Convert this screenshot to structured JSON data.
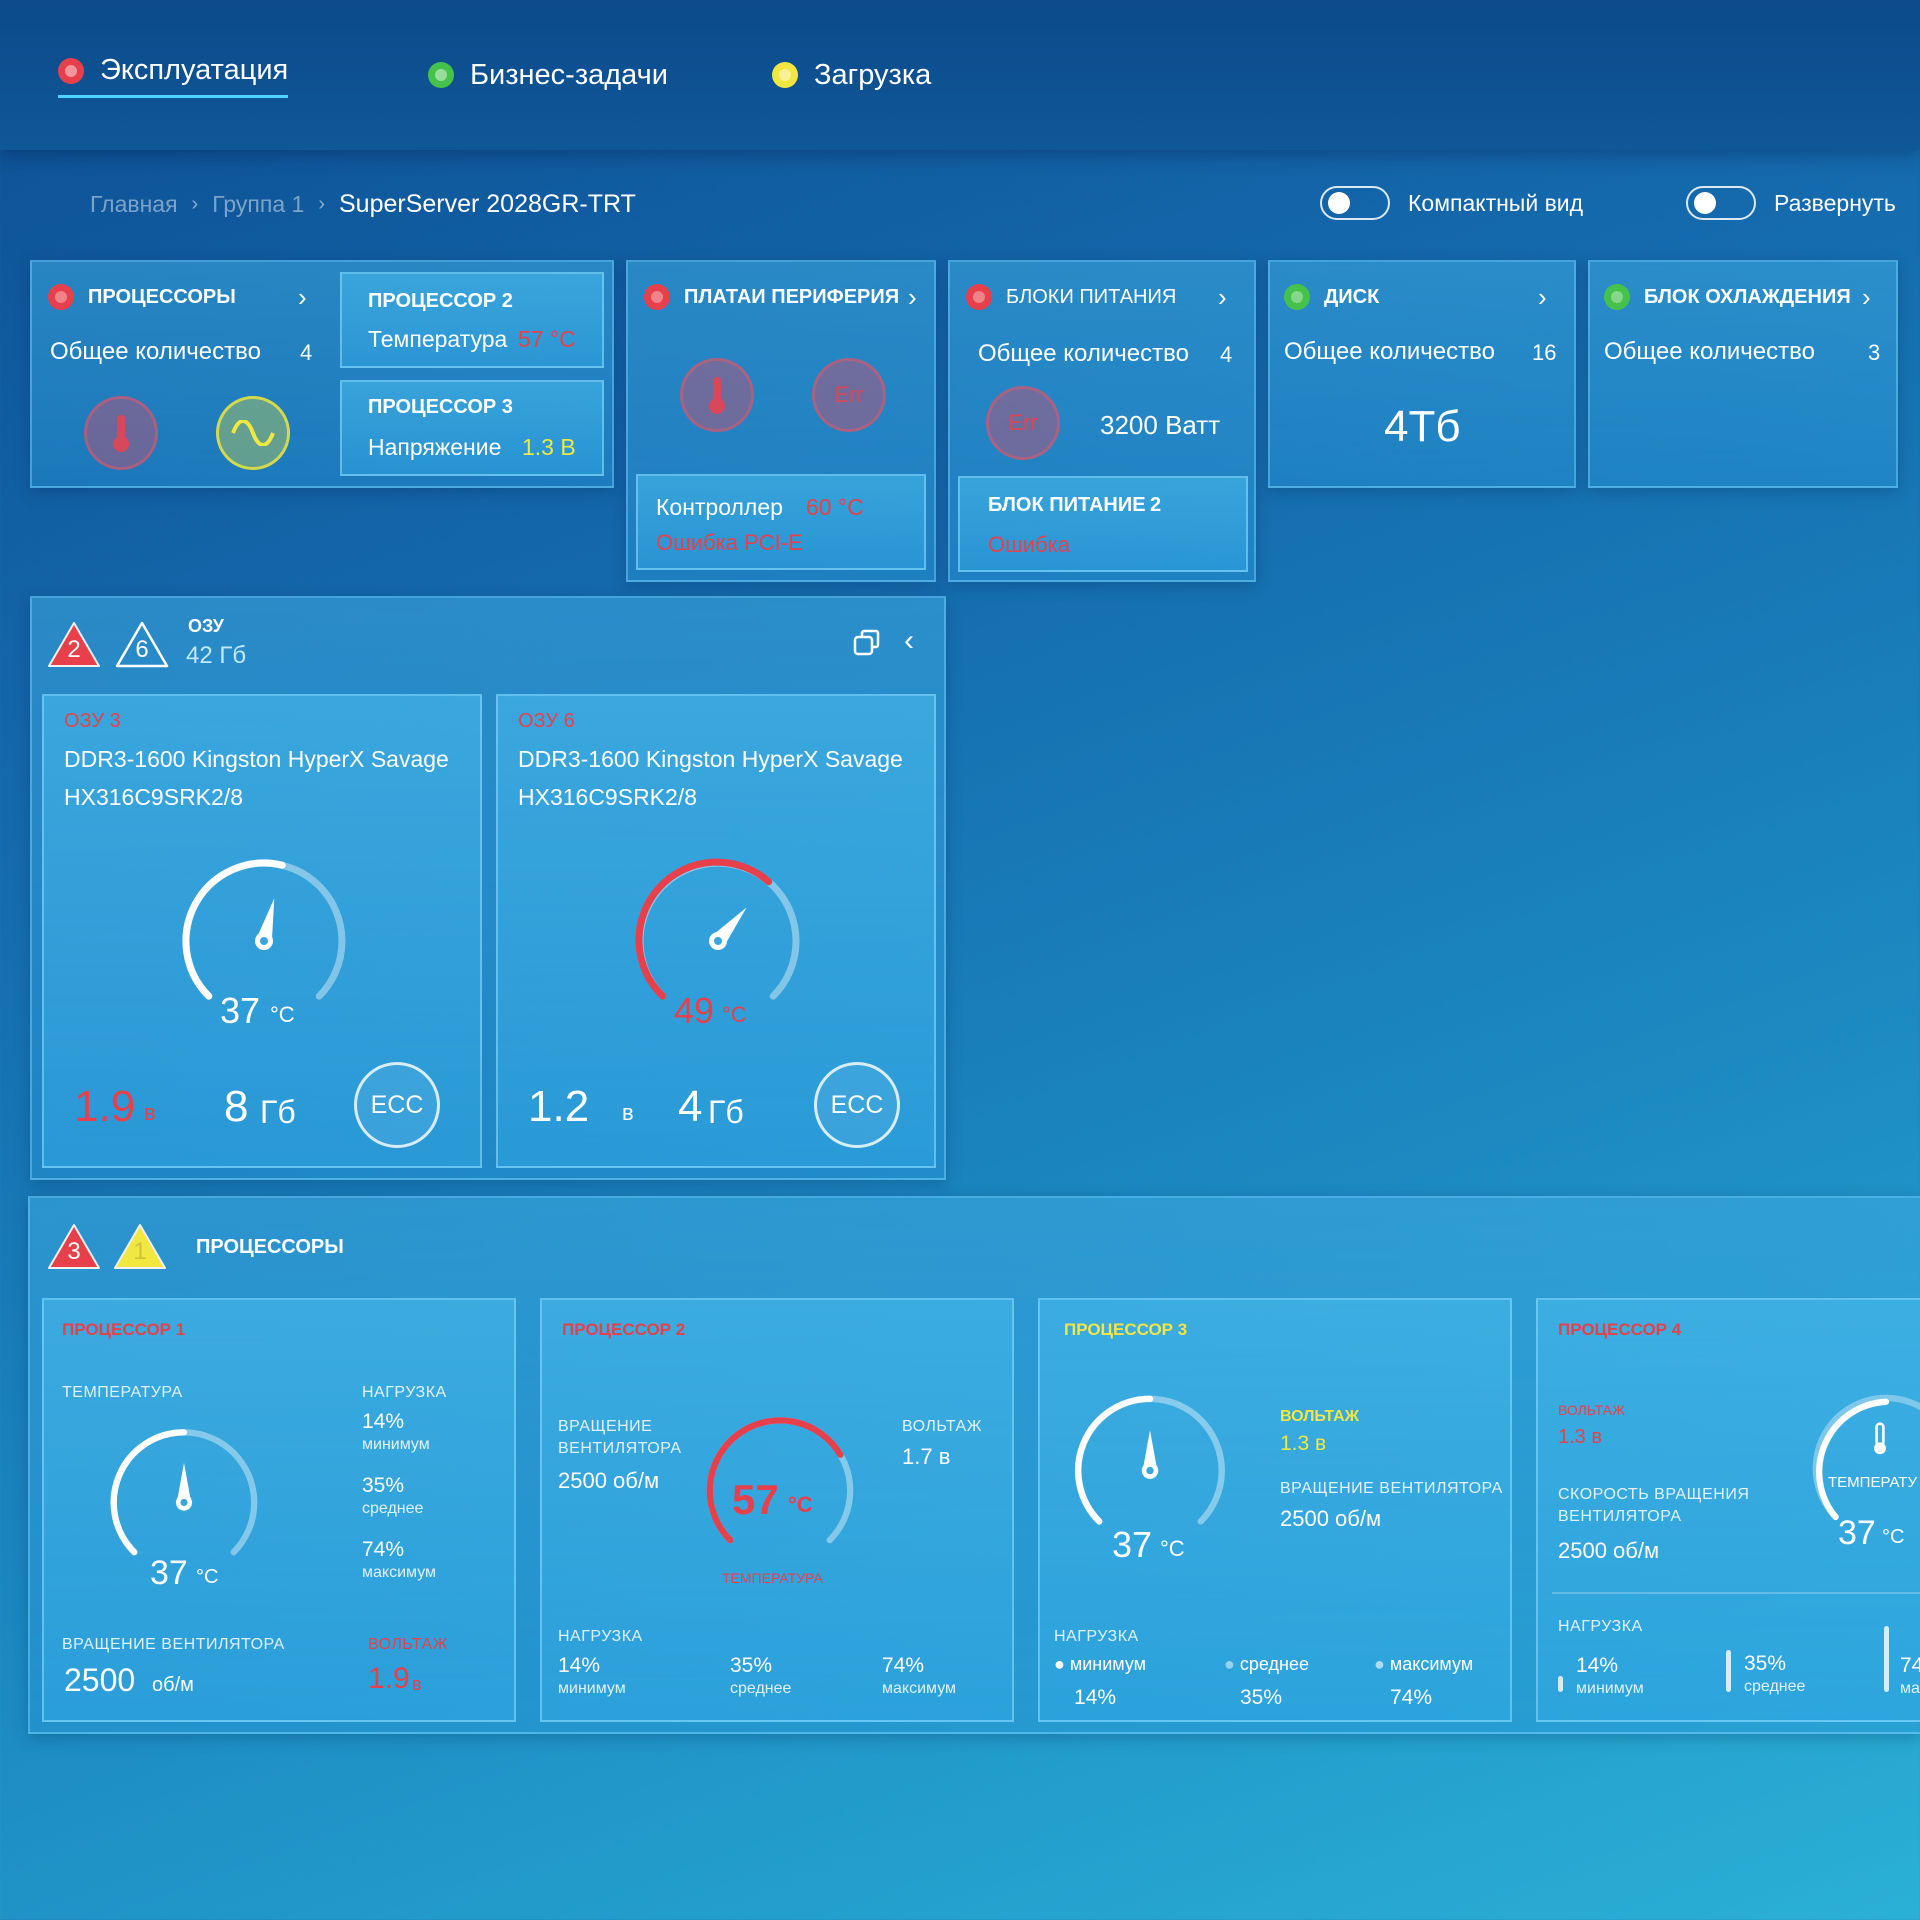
{
  "nav": {
    "tabs": [
      {
        "label": "Эксплуатация",
        "status_color": "#e8404b",
        "active": true
      },
      {
        "label": "Бизнес-задачи",
        "status_color": "#45c24a",
        "active": false
      },
      {
        "label": "Загрузка",
        "status_color": "#f2e640",
        "active": false
      }
    ]
  },
  "breadcrumb": {
    "items": [
      "Главная",
      "Группа 1"
    ],
    "current": "SuperServer 2028GR-TRT"
  },
  "toggles": {
    "compact_label": "Компактный вид",
    "expand_label": "Развернуть"
  },
  "summary": {
    "cpu": {
      "title": "ПРОЦЕССОРЫ",
      "status_color": "#e8404b",
      "count_label": "Общее количество",
      "count": "4",
      "icons": [
        "thermometer-icon",
        "sine-wave-icon"
      ],
      "alerts": [
        {
          "title": "ПРОЦЕССОР 2",
          "label": "Температура",
          "value": "57 °C",
          "value_color": "#e8404b"
        },
        {
          "title": "ПРОЦЕССОР 3",
          "label": "Напряжение",
          "value": "1.3 В",
          "value_color": "#f2e640"
        }
      ]
    },
    "peripherals": {
      "title": "ПЛАТАИ ПЕРИФЕРИЯ",
      "status_color": "#e8404b",
      "icons": [
        "thermometer-icon",
        "error-icon"
      ],
      "icon_err_text": "Err",
      "alert": {
        "label": "Контроллер",
        "value": "60 °C",
        "error": "Ошибка PCI-E"
      }
    },
    "psu": {
      "title": "БЛОКИ ПИТАНИЯ",
      "status_color": "#e8404b",
      "count_label": "Общее количество",
      "count": "4",
      "icon_err_text": "Err",
      "power": "3200 Ватт",
      "alert": {
        "title": "БЛОК ПИТАНИЕ",
        "number": "2",
        "error": "Ошибка"
      }
    },
    "disk": {
      "title": "ДИСК",
      "status_color": "#45c24a",
      "count_label": "Общее количество",
      "count": "16",
      "capacity": "4Тб"
    },
    "cooling": {
      "title": "БЛОК ОХЛАЖДЕНИЯ",
      "status_color": "#45c24a",
      "count_label": "Общее количество",
      "count": "3"
    }
  },
  "ram": {
    "title": "ОЗУ",
    "total": "42 Гб",
    "alerts_red": "2",
    "alerts_white": "6",
    "modules": [
      {
        "slot": "ОЗУ 3",
        "model_line1": "DDR3-1600 Kingston HyperX Savage",
        "model_line2": "HX316C9SRK2/8",
        "temp_value": "37",
        "temp_unit": "°C",
        "temp_level": 0.55,
        "hot": false,
        "voltage": "1.9",
        "voltage_unit": "в",
        "voltage_color": "#e8404b",
        "size": "8",
        "size_unit": "Гб",
        "ecc": "ECC"
      },
      {
        "slot": "ОЗУ 6",
        "model_line1": "DDR3-1600 Kingston HyperX Savage",
        "model_line2": "HX316C9SRK2/8",
        "temp_value": "49",
        "temp_unit": "°C",
        "temp_level": 0.65,
        "hot": true,
        "voltage": "1.2",
        "voltage_unit": "в",
        "voltage_color": "#ffffff",
        "size": "4",
        "size_unit": "Гб",
        "ecc": "ECC"
      }
    ]
  },
  "cpus": {
    "title": "ПРОЦЕССОРЫ",
    "alerts_red": "3",
    "alerts_yellow": "1",
    "cards": [
      {
        "name": "ПРОЦЕССОР 1",
        "name_color": "#e8404b",
        "temp_label": "ТЕМПЕРАТУРА",
        "temp_value": "37",
        "temp_unit": "°C",
        "temp_level": 0.5,
        "load_label": "НАГРУЗКА",
        "load": [
          {
            "value": "14%",
            "label": "минимум"
          },
          {
            "value": "35%",
            "label": "среднее"
          },
          {
            "value": "74%",
            "label": "максимум"
          }
        ],
        "fan_label": "ВРАЩЕНИЕ ВЕНТИЛЯТОРА",
        "fan_value": "2500",
        "fan_unit": "об/м",
        "volt_label": "ВОЛЬТАЖ",
        "volt_value": "1.9",
        "volt_unit": "в"
      },
      {
        "name": "ПРОЦЕССОР 2",
        "name_color": "#e8404b",
        "fan_label_1": "ВРАЩЕНИЕ",
        "fan_label_2": "ВЕНТИЛЯТОРА",
        "fan_value": "2500 об/м",
        "temp_value": "57",
        "temp_unit": "°C",
        "temp_label": "ТЕМПЕРАТУРА",
        "temp_level": 0.72,
        "volt_label": "ВОЛЬТАЖ",
        "volt_value": "1.7 в",
        "load_label": "НАГРУЗКА",
        "load": [
          {
            "value": "14%",
            "label": "минимум"
          },
          {
            "value": "35%",
            "label": "среднее"
          },
          {
            "value": "74%",
            "label": "максимум"
          }
        ]
      },
      {
        "name": "ПРОЦЕССОР 3",
        "name_color": "#f2e640",
        "temp_value": "37",
        "temp_unit": "°C",
        "temp_level": 0.5,
        "volt_label": "ВОЛЬТАЖ",
        "volt_value": "1.3 в",
        "fan_label": "ВРАЩЕНИЕ ВЕНТИЛЯТОРА",
        "fan_value": "2500 об/м",
        "load_label": "НАГРУЗКА",
        "load": [
          {
            "value": "14%",
            "label": "минимум"
          },
          {
            "value": "35%",
            "label": "среднее"
          },
          {
            "value": "74%",
            "label": "максимум"
          }
        ]
      },
      {
        "name": "ПРОЦЕССОР 4",
        "name_color": "#e8404b",
        "volt_label": "ВОЛЬТАЖ",
        "volt_value": "1.3 в",
        "fan_label_1": "СКОРОСТЬ ВРАЩЕНИЯ",
        "fan_label_2": "ВЕНТИЛЯТОРА",
        "fan_value": "2500 об/м",
        "temp_label": "ТЕМПЕРАТУ",
        "temp_value": "37",
        "temp_unit": "°C",
        "load_label": "НАГРУЗКА",
        "load": [
          {
            "value": "14%",
            "label": "минимум"
          },
          {
            "value": "35%",
            "label": "среднее"
          },
          {
            "value": "74",
            "label": "ма"
          }
        ]
      }
    ]
  }
}
